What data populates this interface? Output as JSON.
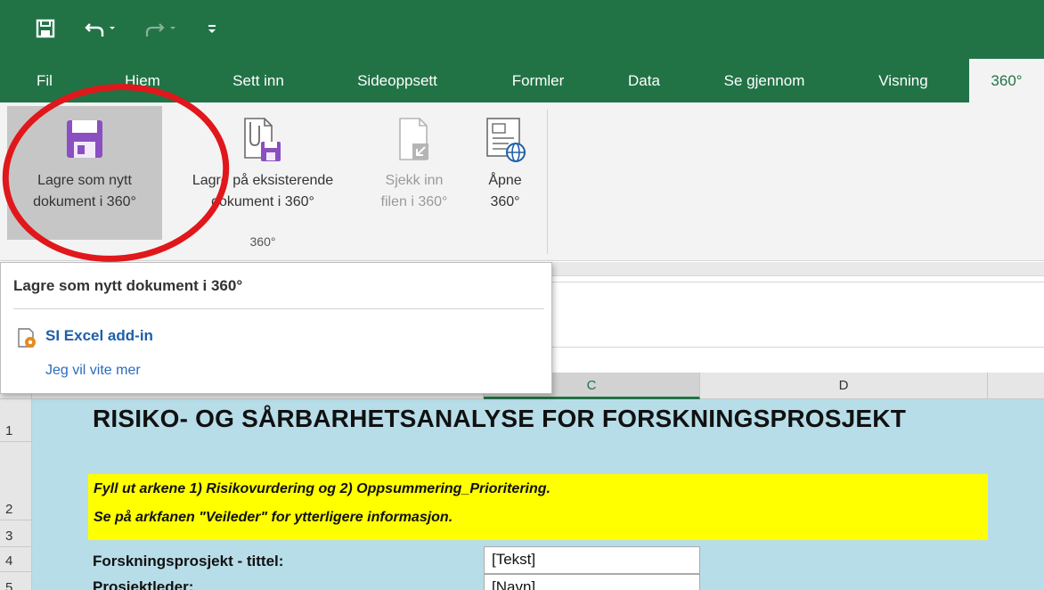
{
  "colors": {
    "brand": "#217346",
    "annotation": "#e0171b",
    "sheet_bg": "#b7dde8",
    "highlight": "#ffff00",
    "save_icon": "#8a4fc0"
  },
  "qat": {
    "save_icon": "floppy-disk-icon",
    "undo_icon": "undo-icon",
    "redo_icon": "redo-icon",
    "customize_icon": "customize-qat-icon"
  },
  "tabs": [
    {
      "label": "Fil"
    },
    {
      "label": "Hjem"
    },
    {
      "label": "Sett inn"
    },
    {
      "label": "Sideoppsett"
    },
    {
      "label": "Formler"
    },
    {
      "label": "Data"
    },
    {
      "label": "Se gjennom"
    },
    {
      "label": "Visning"
    },
    {
      "label": "360°"
    }
  ],
  "ribbon": {
    "group_label": "360°",
    "buttons": [
      {
        "line1": "Lagre som nytt",
        "line2": "dokument i 360°",
        "icon": "floppy-disk-icon"
      },
      {
        "line1": "Lagre på eksisterende",
        "line2": "dokument i 360°",
        "icon": "attach-save-icon"
      },
      {
        "line1": "Sjekk inn",
        "line2": "filen i 360°",
        "icon": "check-in-icon"
      },
      {
        "line1": "Åpne",
        "line2": "360°",
        "icon": "open-web-icon"
      }
    ]
  },
  "tooltip": {
    "title": "Lagre som nytt dokument i 360°",
    "addin_name": "SI Excel add-in",
    "learn_more": "Jeg vil vite mer"
  },
  "columns": [
    {
      "label": "C"
    },
    {
      "label": "D"
    }
  ],
  "rows": [
    {
      "label": "1"
    },
    {
      "label": "2"
    },
    {
      "label": "3"
    },
    {
      "label": "4"
    },
    {
      "label": "5"
    }
  ],
  "sheet": {
    "title": "RISIKO- OG SÅRBARHETSANALYSE FOR FORSKNINGSPROSJEKT",
    "instruction_1": "Fyll ut arkene 1) Risikovurdering og 2) Oppsummering_Prioritering.",
    "instruction_2": "Se på arkfanen \"Veileder\" for ytterligere informasjon.",
    "field_title_label": "Forskningsprosjekt - tittel:",
    "field_title_value": "[Tekst]",
    "field_leader_label": "Prosjektleder:",
    "field_leader_value": "[Navn]"
  }
}
